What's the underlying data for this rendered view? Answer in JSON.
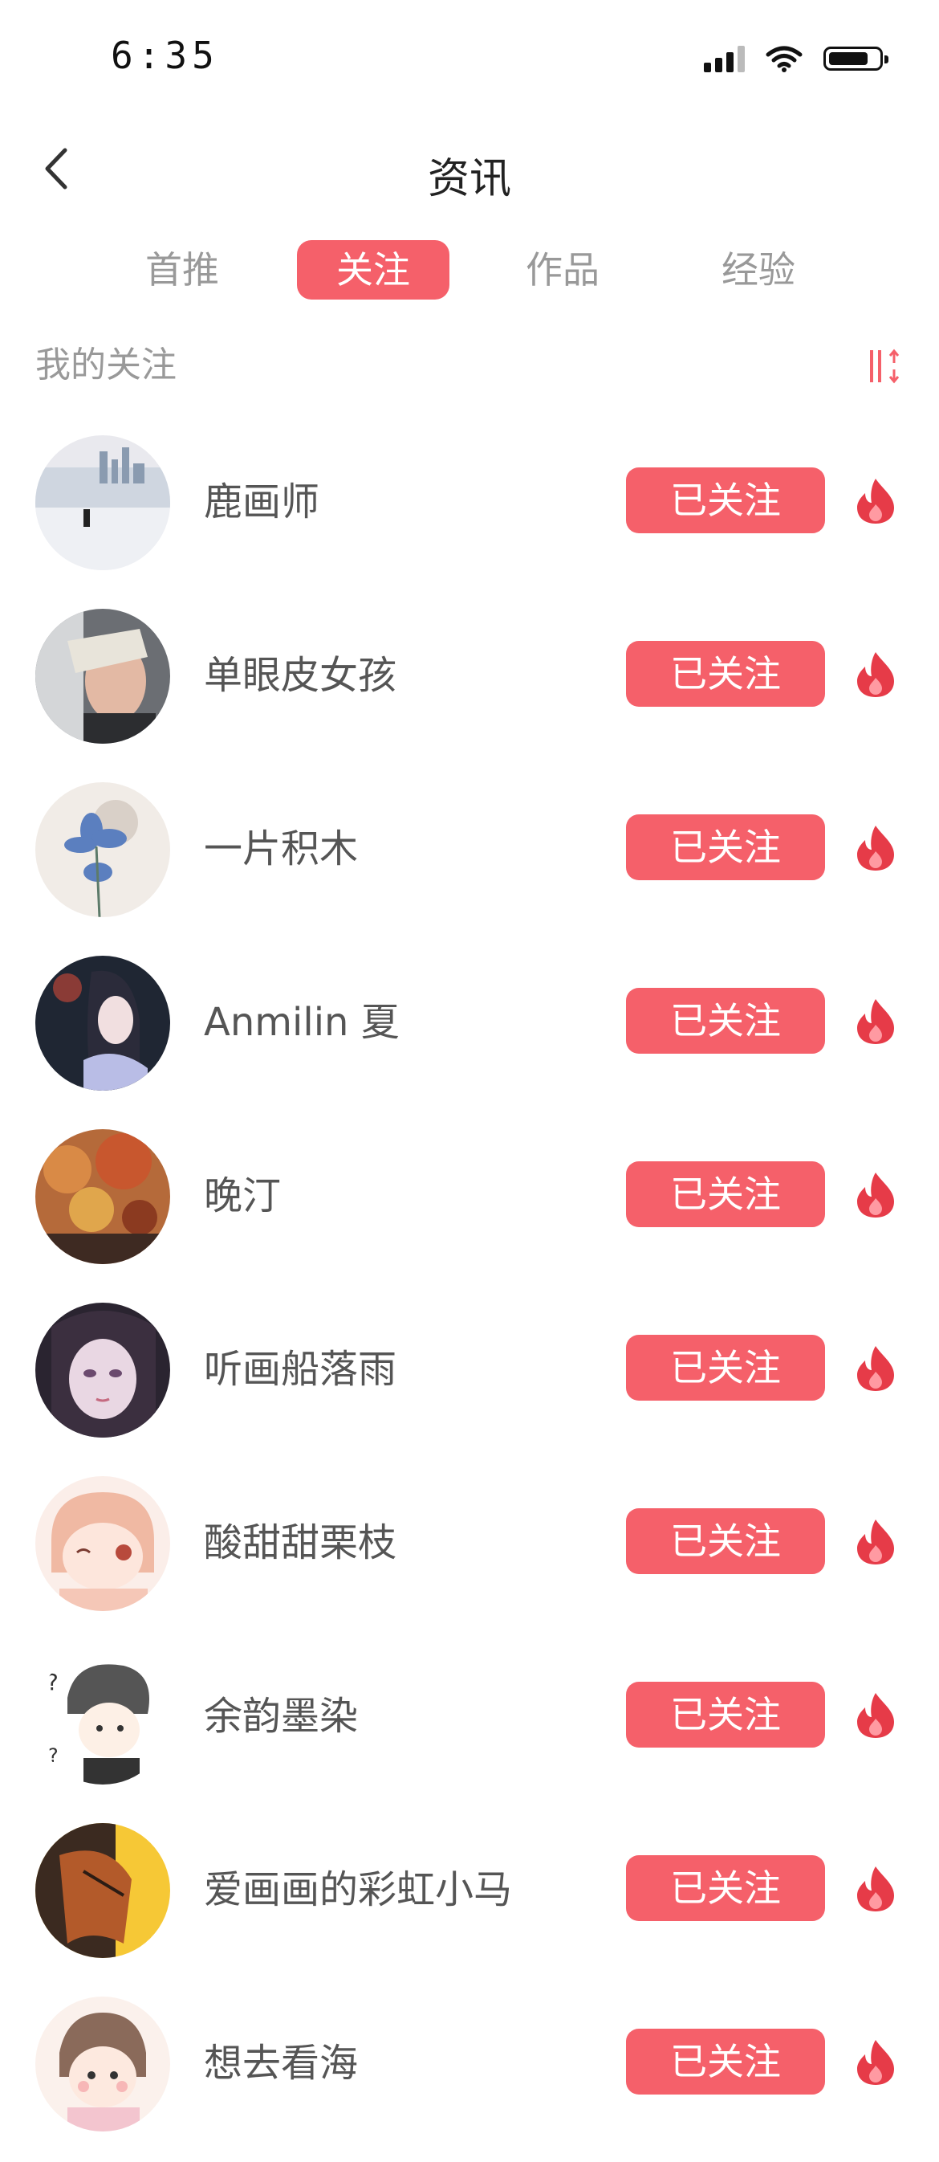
{
  "status": {
    "time": "6:35"
  },
  "header": {
    "title": "资讯"
  },
  "tabs": [
    {
      "label": "首推"
    },
    {
      "label": "关注"
    },
    {
      "label": "作品"
    },
    {
      "label": "经验"
    }
  ],
  "section": {
    "title": "我的关注"
  },
  "users": [
    {
      "name": "鹿画师",
      "button": "已关注"
    },
    {
      "name": "单眼皮女孩",
      "button": "已关注"
    },
    {
      "name": "一片积木",
      "button": "已关注"
    },
    {
      "name": "Anmilin 夏",
      "button": "已关注"
    },
    {
      "name": "晚汀",
      "button": "已关注"
    },
    {
      "name": "听画船落雨",
      "button": "已关注"
    },
    {
      "name": "酸甜甜栗枝",
      "button": "已关注"
    },
    {
      "name": "余韵墨染",
      "button": "已关注"
    },
    {
      "name": "爱画画的彩虹小马",
      "button": "已关注"
    },
    {
      "name": "想去看海",
      "button": "已关注"
    }
  ],
  "colors": {
    "accent": "#f5606a",
    "fire": "#e63b48"
  },
  "icons": {
    "back": "chevron-left-icon",
    "sort": "sort-icon",
    "flame": "flame-icon"
  }
}
